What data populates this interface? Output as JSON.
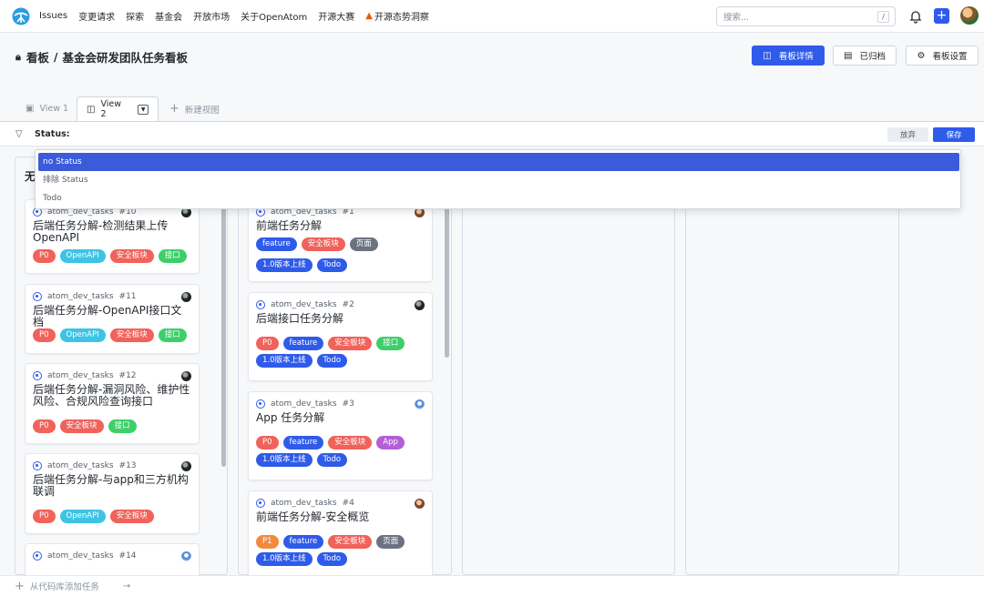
{
  "nav": {
    "items": [
      "Issues",
      "变更请求",
      "探索",
      "基金会",
      "开放市场",
      "关于OpenAtom",
      "开源大赛"
    ],
    "highlight": "开源态势洞察",
    "search_placeholder": "搜索...",
    "search_shortcut": "/",
    "plus": "+"
  },
  "header": {
    "crumb_root": "看板",
    "crumb_sep": "/",
    "crumb_page": "基金会研发团队任务看板",
    "btn_details": "看板详情",
    "btn_archived": "已归档",
    "btn_settings": "看板设置"
  },
  "tabs": {
    "view1": "View 1",
    "view2": "View 2",
    "new_view": "新建视图"
  },
  "filter": {
    "value": "Status:",
    "discard": "放弃",
    "save": "保存"
  },
  "dropdown": {
    "options": [
      "no Status",
      "排除 Status",
      "Todo"
    ]
  },
  "columns": {
    "col1_title": "无"
  },
  "col1_cards": [
    {
      "repo": "atom_dev_tasks",
      "num": "#10",
      "title": "后端任务分解-检测结果上传OpenAPI",
      "tags": [
        "P0",
        "OpenAPI",
        "安全板块",
        "接口"
      ]
    },
    {
      "repo": "atom_dev_tasks",
      "num": "#11",
      "title": "后端任务分解-OpenAPI接口文档",
      "tags": [
        "P0",
        "OpenAPI",
        "安全板块",
        "接口"
      ]
    },
    {
      "repo": "atom_dev_tasks",
      "num": "#12",
      "title": "后端任务分解-漏洞风险、维护性风险、合规风险查询接口",
      "tags": [
        "P0",
        "安全板块",
        "接口"
      ]
    },
    {
      "repo": "atom_dev_tasks",
      "num": "#13",
      "title": "后端任务分解-与app和三方机构联调",
      "tags": [
        "P0",
        "OpenAPI",
        "安全板块"
      ]
    },
    {
      "repo": "atom_dev_tasks",
      "num": "#14"
    }
  ],
  "col2_cards": [
    {
      "repo": "atom_dev_tasks",
      "num": "#1",
      "title": "前端任务分解",
      "tags": [
        "feature",
        "安全板块",
        "页面",
        "1.0版本上线",
        "Todo"
      ]
    },
    {
      "repo": "atom_dev_tasks",
      "num": "#2",
      "title": "后端接口任务分解",
      "tags": [
        "P0",
        "feature",
        "安全板块",
        "接口",
        "1.0版本上线",
        "Todo"
      ]
    },
    {
      "repo": "atom_dev_tasks",
      "num": "#3",
      "title": "App 任务分解",
      "tags": [
        "P0",
        "feature",
        "安全板块",
        "App",
        "1.0版本上线",
        "Todo"
      ]
    },
    {
      "repo": "atom_dev_tasks",
      "num": "#4",
      "title": "前端任务分解-安全概览",
      "tags": [
        "P1",
        "feature",
        "安全板块",
        "页面",
        "1.0版本上线",
        "Todo"
      ]
    }
  ],
  "bottom": {
    "add_label": "从代码库添加任务"
  },
  "colors": {
    "primary": "#2f5bea",
    "p0": "#f0625a",
    "p1": "#f18a3c",
    "openapi": "#3ec3e4",
    "api": "#3ecf6a",
    "page": "#6b7280",
    "app": "#b45fd6"
  }
}
